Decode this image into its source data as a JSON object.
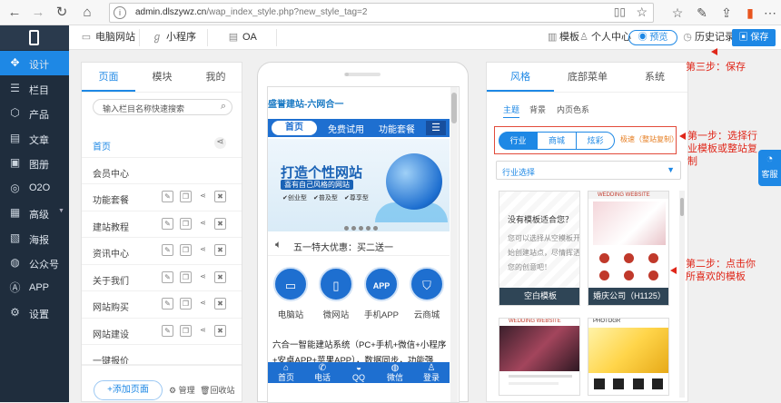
{
  "browser": {
    "url_domain": "admin.dlszywz.cn",
    "url_path": "/wap_index_style.php?new_style_tag=2"
  },
  "sidebar": {
    "items": [
      {
        "label": "设计",
        "icon": "design-icon"
      },
      {
        "label": "栏目",
        "icon": "list-icon"
      },
      {
        "label": "产品",
        "icon": "box-icon"
      },
      {
        "label": "文章",
        "icon": "article-icon"
      },
      {
        "label": "图册",
        "icon": "image-icon"
      },
      {
        "label": "O2O",
        "icon": "o2o-icon"
      },
      {
        "label": "高级",
        "icon": "advanced-icon"
      },
      {
        "label": "海报",
        "icon": "poster-icon"
      },
      {
        "label": "公众号",
        "icon": "wechat-icon"
      },
      {
        "label": "APP",
        "icon": "app-icon"
      },
      {
        "label": "设置",
        "icon": "gear-icon"
      }
    ]
  },
  "topbar": {
    "platforms": [
      "电脑网站",
      "小程序",
      "OA"
    ],
    "template": "模板",
    "personal_center": "个人中心",
    "preview": "预览",
    "history": "历史记录",
    "save": "保存"
  },
  "left_panel": {
    "tabs": [
      "页面",
      "模块",
      "我的"
    ],
    "search_placeholder": "输入栏目名称快速搜索",
    "pages": [
      "首页",
      "会员中心",
      "功能套餐",
      "建站教程",
      "资讯中心",
      "关于我们",
      "网站购买",
      "网站建设",
      "一键报价"
    ],
    "add_page": "+添加页面",
    "manage": "管理",
    "recycle": "回收站"
  },
  "phone": {
    "site_title": "盛誉建站-六网合一",
    "nav": [
      "首页",
      "免费试用",
      "功能套餐"
    ],
    "banner_title": "打造个性网站",
    "banner_subtitle": "喜有自己风格的网站",
    "banner_tags": [
      "创业型",
      "普及型",
      "尊享型"
    ],
    "notice": "五一特大优惠：买二送一",
    "quick_links": [
      {
        "label": "电脑站",
        "glyph": "▭"
      },
      {
        "label": "微网站",
        "glyph": "▯"
      },
      {
        "label": "手机APP",
        "glyph": "APP"
      },
      {
        "label": "云商城",
        "glyph": "⛉"
      }
    ],
    "intro": "六合一智能建站系统（PC+手机+微信+小程序+安卓APP+苹果APP），数据同步，功能强大，容",
    "footer": [
      "首页",
      "电话",
      "QQ",
      "微信",
      "登录"
    ]
  },
  "right_panel": {
    "tabs": [
      "风格",
      "底部菜单",
      "系统"
    ],
    "subtabs": [
      "主题",
      "背景",
      "内页色系"
    ],
    "segments": [
      "行业",
      "商城",
      "炫彩"
    ],
    "copy_link": "极速（整站复制）",
    "select_value": "行业选择",
    "blank_title": "没有模板适合您？",
    "blank_text": "您可以选择从空模板开始创建站点，尽情挥洒您的创意吧！",
    "blank_button": "空白模板",
    "card2_label": "婚庆公司（H1125）",
    "card2_brand": "WEDDING WEBSITE",
    "card3_brand": "WEDDING WEBSITE",
    "card4_brand": "PHOTOGR"
  },
  "annotations": {
    "step3": "第三步：保存",
    "step1": "第一步：选择行业模板或整站复制",
    "step2": "第二步：点击你所喜欢的模板"
  },
  "kefu": "客服",
  "colors": {
    "accent": "#1e88e5",
    "sidebar": "#1f2d3d",
    "annotation": "#e0271a"
  }
}
